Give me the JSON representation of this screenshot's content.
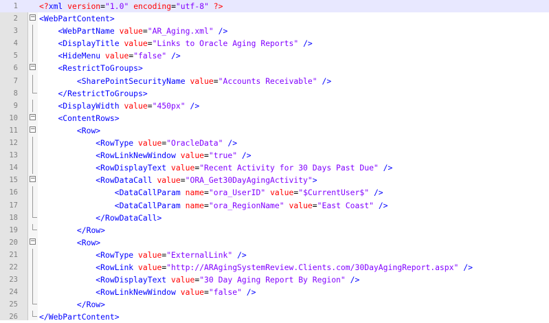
{
  "editor": {
    "lines": [
      {
        "n": "1",
        "fold": "none",
        "current": true,
        "tokens": [
          {
            "c": "pi",
            "s": "<?"
          },
          {
            "c": "t",
            "s": "xml"
          },
          {
            "c": "eq",
            "s": " "
          },
          {
            "c": "a",
            "s": "version"
          },
          {
            "c": "eq",
            "s": "="
          },
          {
            "c": "v",
            "s": "\"1.0\""
          },
          {
            "c": "eq",
            "s": " "
          },
          {
            "c": "a",
            "s": "encoding"
          },
          {
            "c": "eq",
            "s": "="
          },
          {
            "c": "v",
            "s": "\"utf-8\""
          },
          {
            "c": "eq",
            "s": " "
          },
          {
            "c": "pi",
            "s": "?>"
          }
        ]
      },
      {
        "n": "2",
        "fold": "open",
        "tokens": [
          {
            "c": "t",
            "s": "<WebPartContent>"
          }
        ]
      },
      {
        "n": "3",
        "fold": "line",
        "tokens": [
          {
            "c": "eq",
            "s": "    "
          },
          {
            "c": "t",
            "s": "<WebPartName"
          },
          {
            "c": "eq",
            "s": " "
          },
          {
            "c": "a",
            "s": "value"
          },
          {
            "c": "eq",
            "s": "="
          },
          {
            "c": "v",
            "s": "\"AR_Aging.xml\""
          },
          {
            "c": "eq",
            "s": " "
          },
          {
            "c": "t",
            "s": "/>"
          }
        ]
      },
      {
        "n": "4",
        "fold": "line",
        "tokens": [
          {
            "c": "eq",
            "s": "    "
          },
          {
            "c": "t",
            "s": "<DisplayTitle"
          },
          {
            "c": "eq",
            "s": " "
          },
          {
            "c": "a",
            "s": "value"
          },
          {
            "c": "eq",
            "s": "="
          },
          {
            "c": "v",
            "s": "\"Links to Oracle Aging Reports\""
          },
          {
            "c": "eq",
            "s": " "
          },
          {
            "c": "t",
            "s": "/>"
          }
        ]
      },
      {
        "n": "5",
        "fold": "line",
        "tokens": [
          {
            "c": "eq",
            "s": "    "
          },
          {
            "c": "t",
            "s": "<HideMenu"
          },
          {
            "c": "eq",
            "s": " "
          },
          {
            "c": "a",
            "s": "value"
          },
          {
            "c": "eq",
            "s": "="
          },
          {
            "c": "v",
            "s": "\"false\""
          },
          {
            "c": "eq",
            "s": " "
          },
          {
            "c": "t",
            "s": "/>"
          }
        ]
      },
      {
        "n": "6",
        "fold": "open",
        "tokens": [
          {
            "c": "eq",
            "s": "    "
          },
          {
            "c": "t",
            "s": "<RestrictToGroups>"
          }
        ]
      },
      {
        "n": "7",
        "fold": "line",
        "tokens": [
          {
            "c": "eq",
            "s": "        "
          },
          {
            "c": "t",
            "s": "<SharePointSecurityName"
          },
          {
            "c": "eq",
            "s": " "
          },
          {
            "c": "a",
            "s": "value"
          },
          {
            "c": "eq",
            "s": "="
          },
          {
            "c": "v",
            "s": "\"Accounts Receivable\""
          },
          {
            "c": "eq",
            "s": " "
          },
          {
            "c": "t",
            "s": "/>"
          }
        ]
      },
      {
        "n": "8",
        "fold": "end",
        "tokens": [
          {
            "c": "eq",
            "s": "    "
          },
          {
            "c": "t",
            "s": "</RestrictToGroups>"
          }
        ]
      },
      {
        "n": "9",
        "fold": "line",
        "tokens": [
          {
            "c": "eq",
            "s": "    "
          },
          {
            "c": "t",
            "s": "<DisplayWidth"
          },
          {
            "c": "eq",
            "s": " "
          },
          {
            "c": "a",
            "s": "value"
          },
          {
            "c": "eq",
            "s": "="
          },
          {
            "c": "v",
            "s": "\"450px\""
          },
          {
            "c": "eq",
            "s": " "
          },
          {
            "c": "t",
            "s": "/>"
          }
        ]
      },
      {
        "n": "10",
        "fold": "open",
        "tokens": [
          {
            "c": "eq",
            "s": "    "
          },
          {
            "c": "t",
            "s": "<ContentRows>"
          }
        ]
      },
      {
        "n": "11",
        "fold": "open",
        "tokens": [
          {
            "c": "eq",
            "s": "        "
          },
          {
            "c": "t",
            "s": "<Row>"
          }
        ]
      },
      {
        "n": "12",
        "fold": "line",
        "tokens": [
          {
            "c": "eq",
            "s": "            "
          },
          {
            "c": "t",
            "s": "<RowType"
          },
          {
            "c": "eq",
            "s": " "
          },
          {
            "c": "a",
            "s": "value"
          },
          {
            "c": "eq",
            "s": "="
          },
          {
            "c": "v",
            "s": "\"OracleData\""
          },
          {
            "c": "eq",
            "s": " "
          },
          {
            "c": "t",
            "s": "/>"
          }
        ]
      },
      {
        "n": "13",
        "fold": "line",
        "tokens": [
          {
            "c": "eq",
            "s": "            "
          },
          {
            "c": "t",
            "s": "<RowLinkNewWindow"
          },
          {
            "c": "eq",
            "s": " "
          },
          {
            "c": "a",
            "s": "value"
          },
          {
            "c": "eq",
            "s": "="
          },
          {
            "c": "v",
            "s": "\"true\""
          },
          {
            "c": "eq",
            "s": " "
          },
          {
            "c": "t",
            "s": "/>"
          }
        ]
      },
      {
        "n": "14",
        "fold": "line",
        "tokens": [
          {
            "c": "eq",
            "s": "            "
          },
          {
            "c": "t",
            "s": "<RowDisplayText"
          },
          {
            "c": "eq",
            "s": " "
          },
          {
            "c": "a",
            "s": "value"
          },
          {
            "c": "eq",
            "s": "="
          },
          {
            "c": "v",
            "s": "\"Recent Activity for 30 Days Past Due\""
          },
          {
            "c": "eq",
            "s": " "
          },
          {
            "c": "t",
            "s": "/>"
          }
        ]
      },
      {
        "n": "15",
        "fold": "open",
        "tokens": [
          {
            "c": "eq",
            "s": "            "
          },
          {
            "c": "t",
            "s": "<RowDataCall"
          },
          {
            "c": "eq",
            "s": " "
          },
          {
            "c": "a",
            "s": "value"
          },
          {
            "c": "eq",
            "s": "="
          },
          {
            "c": "v",
            "s": "\"ORA_Get30DayAgingActivity\""
          },
          {
            "c": "t",
            "s": ">"
          }
        ]
      },
      {
        "n": "16",
        "fold": "line",
        "tokens": [
          {
            "c": "eq",
            "s": "                "
          },
          {
            "c": "t",
            "s": "<DataCallParam"
          },
          {
            "c": "eq",
            "s": " "
          },
          {
            "c": "a",
            "s": "name"
          },
          {
            "c": "eq",
            "s": "="
          },
          {
            "c": "v",
            "s": "\"ora_UserID\""
          },
          {
            "c": "eq",
            "s": " "
          },
          {
            "c": "a",
            "s": "value"
          },
          {
            "c": "eq",
            "s": "="
          },
          {
            "c": "v",
            "s": "\"$CurrentUser$\""
          },
          {
            "c": "eq",
            "s": " "
          },
          {
            "c": "t",
            "s": "/>"
          }
        ]
      },
      {
        "n": "17",
        "fold": "line",
        "tokens": [
          {
            "c": "eq",
            "s": "                "
          },
          {
            "c": "t",
            "s": "<DataCallParam"
          },
          {
            "c": "eq",
            "s": " "
          },
          {
            "c": "a",
            "s": "name"
          },
          {
            "c": "eq",
            "s": "="
          },
          {
            "c": "v",
            "s": "\"ora_RegionName\""
          },
          {
            "c": "eq",
            "s": " "
          },
          {
            "c": "a",
            "s": "value"
          },
          {
            "c": "eq",
            "s": "="
          },
          {
            "c": "v",
            "s": "\"East Coast\""
          },
          {
            "c": "eq",
            "s": " "
          },
          {
            "c": "t",
            "s": "/>"
          }
        ]
      },
      {
        "n": "18",
        "fold": "end",
        "tokens": [
          {
            "c": "eq",
            "s": "            "
          },
          {
            "c": "t",
            "s": "</RowDataCall>"
          }
        ]
      },
      {
        "n": "19",
        "fold": "end",
        "tokens": [
          {
            "c": "eq",
            "s": "        "
          },
          {
            "c": "t",
            "s": "</Row>"
          }
        ]
      },
      {
        "n": "20",
        "fold": "open",
        "tokens": [
          {
            "c": "eq",
            "s": "        "
          },
          {
            "c": "t",
            "s": "<Row>"
          }
        ]
      },
      {
        "n": "21",
        "fold": "line",
        "tokens": [
          {
            "c": "eq",
            "s": "            "
          },
          {
            "c": "t",
            "s": "<RowType"
          },
          {
            "c": "eq",
            "s": " "
          },
          {
            "c": "a",
            "s": "value"
          },
          {
            "c": "eq",
            "s": "="
          },
          {
            "c": "v",
            "s": "\"ExternalLink\""
          },
          {
            "c": "eq",
            "s": " "
          },
          {
            "c": "t",
            "s": "/>"
          }
        ]
      },
      {
        "n": "22",
        "fold": "line",
        "tokens": [
          {
            "c": "eq",
            "s": "            "
          },
          {
            "c": "t",
            "s": "<RowLink"
          },
          {
            "c": "eq",
            "s": " "
          },
          {
            "c": "a",
            "s": "value"
          },
          {
            "c": "eq",
            "s": "="
          },
          {
            "c": "v",
            "s": "\"http://ARAgingSystemReview.Clients.com/30DayAgingReport.aspx\""
          },
          {
            "c": "eq",
            "s": " "
          },
          {
            "c": "t",
            "s": "/>"
          }
        ]
      },
      {
        "n": "23",
        "fold": "line",
        "tokens": [
          {
            "c": "eq",
            "s": "            "
          },
          {
            "c": "t",
            "s": "<RowDisplayText"
          },
          {
            "c": "eq",
            "s": " "
          },
          {
            "c": "a",
            "s": "value"
          },
          {
            "c": "eq",
            "s": "="
          },
          {
            "c": "v",
            "s": "\"30 Day Aging Report By Region\""
          },
          {
            "c": "eq",
            "s": " "
          },
          {
            "c": "t",
            "s": "/>"
          }
        ]
      },
      {
        "n": "24",
        "fold": "line",
        "tokens": [
          {
            "c": "eq",
            "s": "            "
          },
          {
            "c": "t",
            "s": "<RowLinkNewWindow"
          },
          {
            "c": "eq",
            "s": " "
          },
          {
            "c": "a",
            "s": "value"
          },
          {
            "c": "eq",
            "s": "="
          },
          {
            "c": "v",
            "s": "\"false\""
          },
          {
            "c": "eq",
            "s": " "
          },
          {
            "c": "t",
            "s": "/>"
          }
        ]
      },
      {
        "n": "25",
        "fold": "end",
        "tokens": [
          {
            "c": "eq",
            "s": "        "
          },
          {
            "c": "t",
            "s": "</Row>"
          }
        ]
      },
      {
        "n": "26",
        "fold": "end",
        "tokens": [
          {
            "c": "t",
            "s": "</WebPartContent>"
          }
        ]
      }
    ],
    "colors": {
      "tag": "#0000ff",
      "attribute": "#ff0000",
      "value": "#8000ff",
      "current_line": "#e8e8ff",
      "gutter": "#e4e4e4"
    }
  }
}
